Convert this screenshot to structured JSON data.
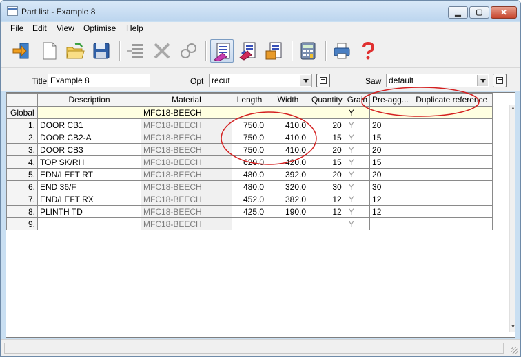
{
  "window": {
    "title": "Part list - Example 8",
    "app_icon": "table-icon"
  },
  "window_controls": {
    "minimize_glyph": "▁",
    "maximize_glyph": "▢",
    "close_glyph": "✕"
  },
  "menu": [
    "File",
    "Edit",
    "View",
    "Optimise",
    "Help"
  ],
  "toolbar": {
    "icons": [
      "exit-icon",
      "new-document-icon",
      "open-folder-icon",
      "save-disk-icon",
      "delete-rows-icon",
      "cut-scissors-icon",
      "link-icon",
      "part-list-icon",
      "stock-list-icon",
      "board-list-icon",
      "calculator-icon",
      "print-icon",
      "help-icon"
    ],
    "active": "part-list-icon"
  },
  "fields": {
    "title_label": "Title",
    "title_value": "Example 8",
    "opt_label": "Opt",
    "opt_value": "recut",
    "saw_label": "Saw",
    "saw_value": "default"
  },
  "grid": {
    "columns": [
      "",
      "Description",
      "Material",
      "Length",
      "Width",
      "Quantity",
      "Grain",
      "Pre-agg...",
      "Duplicate reference"
    ],
    "global_row": {
      "label": "Global",
      "description": "",
      "material": "MFC18-BEECH",
      "length": "",
      "width": "",
      "quantity": "",
      "grain": "Y",
      "preagg": "",
      "dupref": ""
    },
    "rows": [
      {
        "n": "1.",
        "description": "DOOR CB1",
        "material": "MFC18-BEECH",
        "length": "750.0",
        "width": "410.0",
        "quantity": "20",
        "grain": "Y",
        "preagg": "20",
        "dupref": ""
      },
      {
        "n": "2.",
        "description": "DOOR CB2-A",
        "material": "MFC18-BEECH",
        "length": "750.0",
        "width": "410.0",
        "quantity": "15",
        "grain": "Y",
        "preagg": "15",
        "dupref": ""
      },
      {
        "n": "3.",
        "description": "DOOR CB3",
        "material": "MFC18-BEECH",
        "length": "750.0",
        "width": "410.0",
        "quantity": "20",
        "grain": "Y",
        "preagg": "20",
        "dupref": ""
      },
      {
        "n": "4.",
        "description": "TOP SK/RH",
        "material": "MFC18-BEECH",
        "length": "620.0",
        "width": "420.0",
        "quantity": "15",
        "grain": "Y",
        "preagg": "15",
        "dupref": ""
      },
      {
        "n": "5.",
        "description": "EDN/LEFT RT",
        "material": "MFC18-BEECH",
        "length": "480.0",
        "width": "392.0",
        "quantity": "20",
        "grain": "Y",
        "preagg": "20",
        "dupref": ""
      },
      {
        "n": "6.",
        "description": "END 36/F",
        "material": "MFC18-BEECH",
        "length": "480.0",
        "width": "320.0",
        "quantity": "30",
        "grain": "Y",
        "preagg": "30",
        "dupref": ""
      },
      {
        "n": "7.",
        "description": "END/LEFT RX",
        "material": "MFC18-BEECH",
        "length": "452.0",
        "width": "382.0",
        "quantity": "12",
        "grain": "Y",
        "preagg": "12",
        "dupref": ""
      },
      {
        "n": "8.",
        "description": "PLINTH TD",
        "material": "MFC18-BEECH",
        "length": "425.0",
        "width": "190.0",
        "quantity": "12",
        "grain": "Y",
        "preagg": "12",
        "dupref": ""
      },
      {
        "n": "9.",
        "description": "",
        "material": "MFC18-BEECH",
        "length": "",
        "width": "",
        "quantity": "",
        "grain": "Y",
        "preagg": "",
        "dupref": ""
      }
    ]
  },
  "annotations": {
    "color": "#d42020"
  },
  "colors": {
    "global_row_bg": "#ffffe1",
    "material_fg": "#7d7d7d",
    "window_frame": "#c9dff2"
  }
}
